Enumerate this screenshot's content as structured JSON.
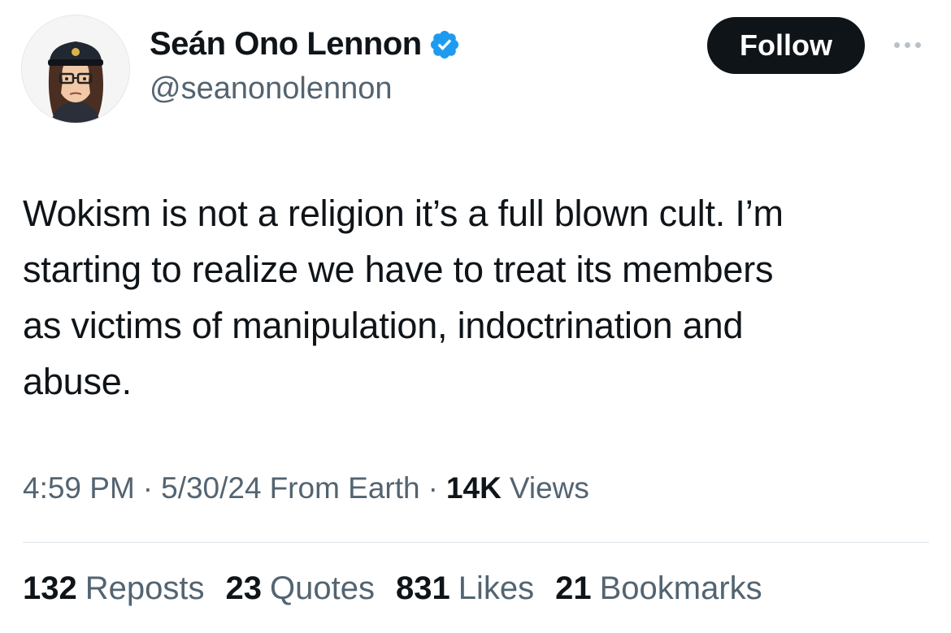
{
  "author": {
    "display_name": "Seán Ono Lennon",
    "handle": "@seanonolennon",
    "verified_badge_color": "#1d9bf0",
    "verified_icon": "verified-badge-icon",
    "avatar_icon": "bitmoji-avatar-police-cap"
  },
  "header": {
    "follow_label": "Follow",
    "more_icon": "more-horizontal-icon"
  },
  "tweet": {
    "text": "Wokism is not a religion it’s a full blown cult. I’m\nstarting to realize we have to treat its members\nas victims of manipulation, indoctrination and\nabuse."
  },
  "meta": {
    "time": "4:59 PM",
    "separator": "·",
    "date": "5/30/24",
    "source": "From Earth",
    "views_count": "14K",
    "views_label": "Views"
  },
  "stats": [
    {
      "count": "132",
      "label": "Reposts"
    },
    {
      "count": "23",
      "label": "Quotes"
    },
    {
      "count": "831",
      "label": "Likes"
    },
    {
      "count": "21",
      "label": "Bookmarks"
    }
  ],
  "colors": {
    "text_primary": "#0f1419",
    "text_secondary": "#536471",
    "follow_bg": "#0f1419",
    "divider": "#dde3e8"
  }
}
